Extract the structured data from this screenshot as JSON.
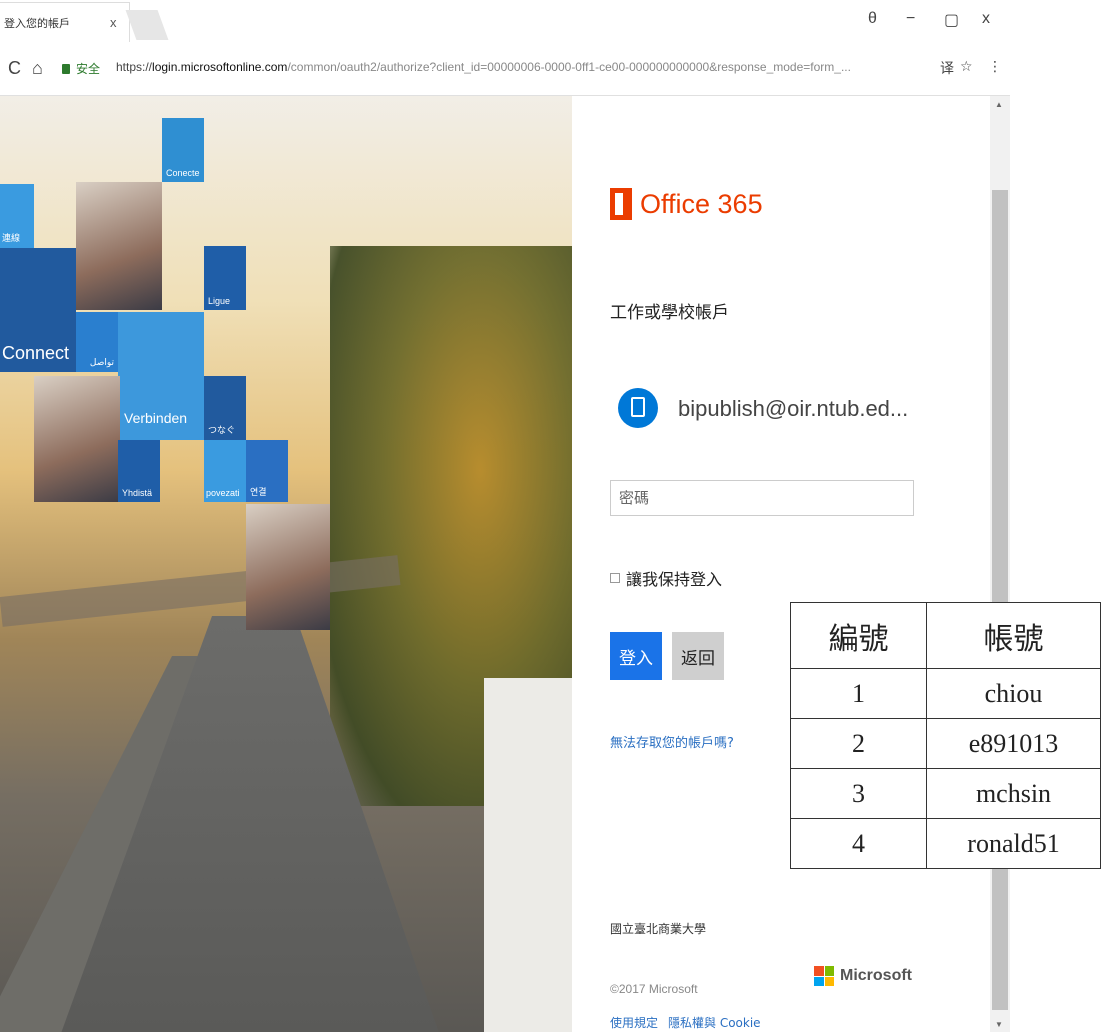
{
  "browser": {
    "tab_title": "登入您的帳戶",
    "tab_close": "x",
    "window_controls": {
      "profile": "θ",
      "minimize": "−",
      "restore": "▢",
      "close": "x"
    },
    "nav": {
      "reload": "C",
      "home": "⌂"
    },
    "secure_label": "安全",
    "url_scheme": "https://",
    "url_host": "login.microsoftonline.com",
    "url_path": "/common/oauth2/authorize?client_id=00000006-0000-0ff1-ce00-000000000000&response_mode=form_...",
    "addr_icons": {
      "translate": "译",
      "bookmark": "☆",
      "menu": "⋮"
    }
  },
  "hero": {
    "tiles": [
      "Conecte",
      "連線",
      "Ligue",
      "Connect",
      "تواصل",
      "Verbinden",
      "つなぐ",
      "Yhdistä",
      "povezati",
      "연결"
    ]
  },
  "signin": {
    "brand": "Office 365",
    "heading": "工作或學校帳戶",
    "account": "bipublish@oir.ntub.ed...",
    "password_placeholder": "密碼",
    "keep_signed_in": "讓我保持登入",
    "signin_button": "登入",
    "back_button": "返回",
    "cant_access": "無法存取您的帳戶嗎?",
    "organization": "國立臺北商業大學",
    "copyright": "©2017 Microsoft",
    "microsoft_label": "Microsoft",
    "footer": {
      "terms": "使用規定",
      "privacy": "隱私權與 Cookie"
    },
    "ms_colors": [
      "#f25022",
      "#7fba00",
      "#00a4ef",
      "#ffb900"
    ]
  },
  "account_table": {
    "headers": [
      "編號",
      "帳號"
    ],
    "rows": [
      [
        "1",
        "chiou"
      ],
      [
        "2",
        "e891013"
      ],
      [
        "3",
        "mchsin"
      ],
      [
        "4",
        "ronald51"
      ]
    ]
  }
}
